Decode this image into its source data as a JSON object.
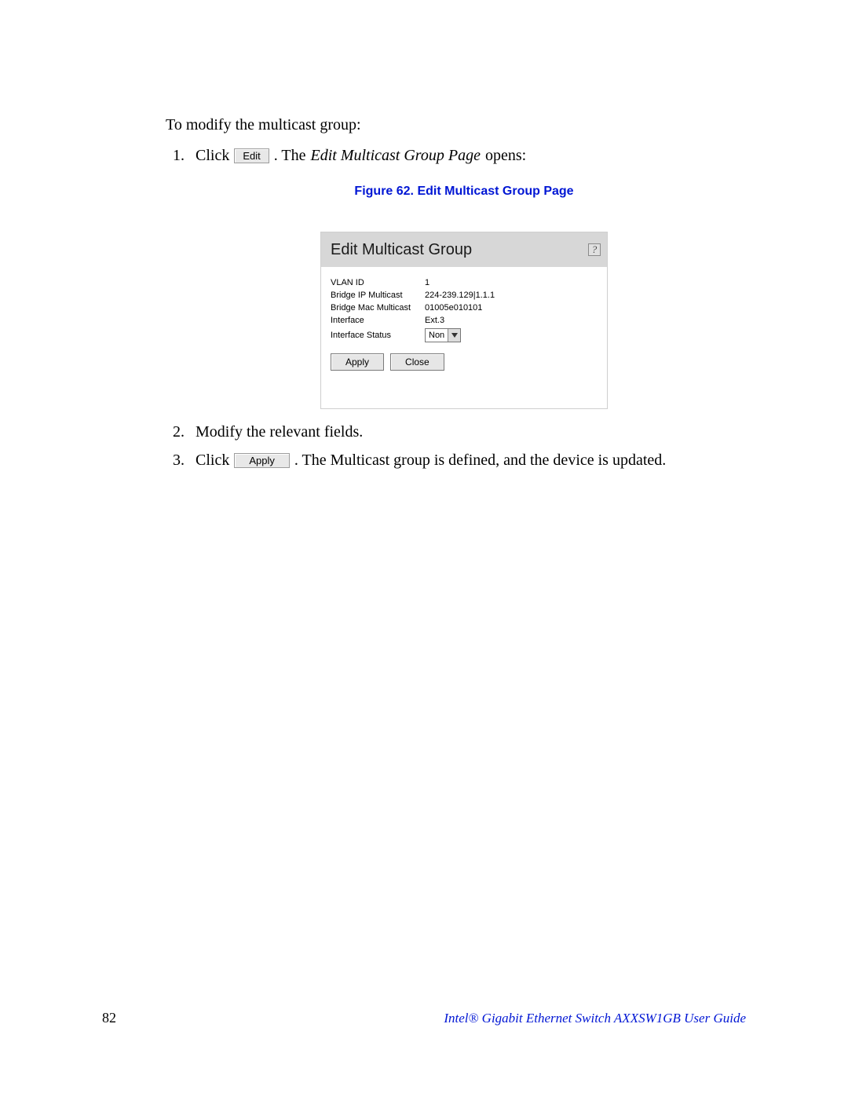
{
  "intro": "To modify the multicast group:",
  "steps": {
    "1": {
      "prefix": "Click",
      "button": "Edit",
      "after_period": ". The ",
      "italic": "Edit Multicast Group Page",
      "tail": " opens:"
    },
    "2": {
      "text": "Modify the relevant fields."
    },
    "3": {
      "prefix": "Click",
      "button": "Apply",
      "tail": ". The Multicast group is defined, and the device is updated."
    }
  },
  "figure": {
    "caption": "Figure 62. Edit Multicast Group Page",
    "dialog_title": "Edit Multicast Group",
    "help": "?",
    "fields": {
      "vlan_id": {
        "label": "VLAN ID",
        "value": "1"
      },
      "bip": {
        "label": "Bridge IP Multicast",
        "value": "224-239.129|1.1.1"
      },
      "bmac": {
        "label": "Bridge Mac Multicast",
        "value": "01005e010101"
      },
      "iface": {
        "label": "Interface",
        "value": "Ext.3"
      },
      "iface_stat": {
        "label": "Interface Status",
        "value": "Non"
      }
    },
    "buttons": {
      "apply": "Apply",
      "close": "Close"
    }
  },
  "footer": {
    "page_number": "82",
    "title": "Intel® Gigabit Ethernet Switch AXXSW1GB User Guide"
  }
}
